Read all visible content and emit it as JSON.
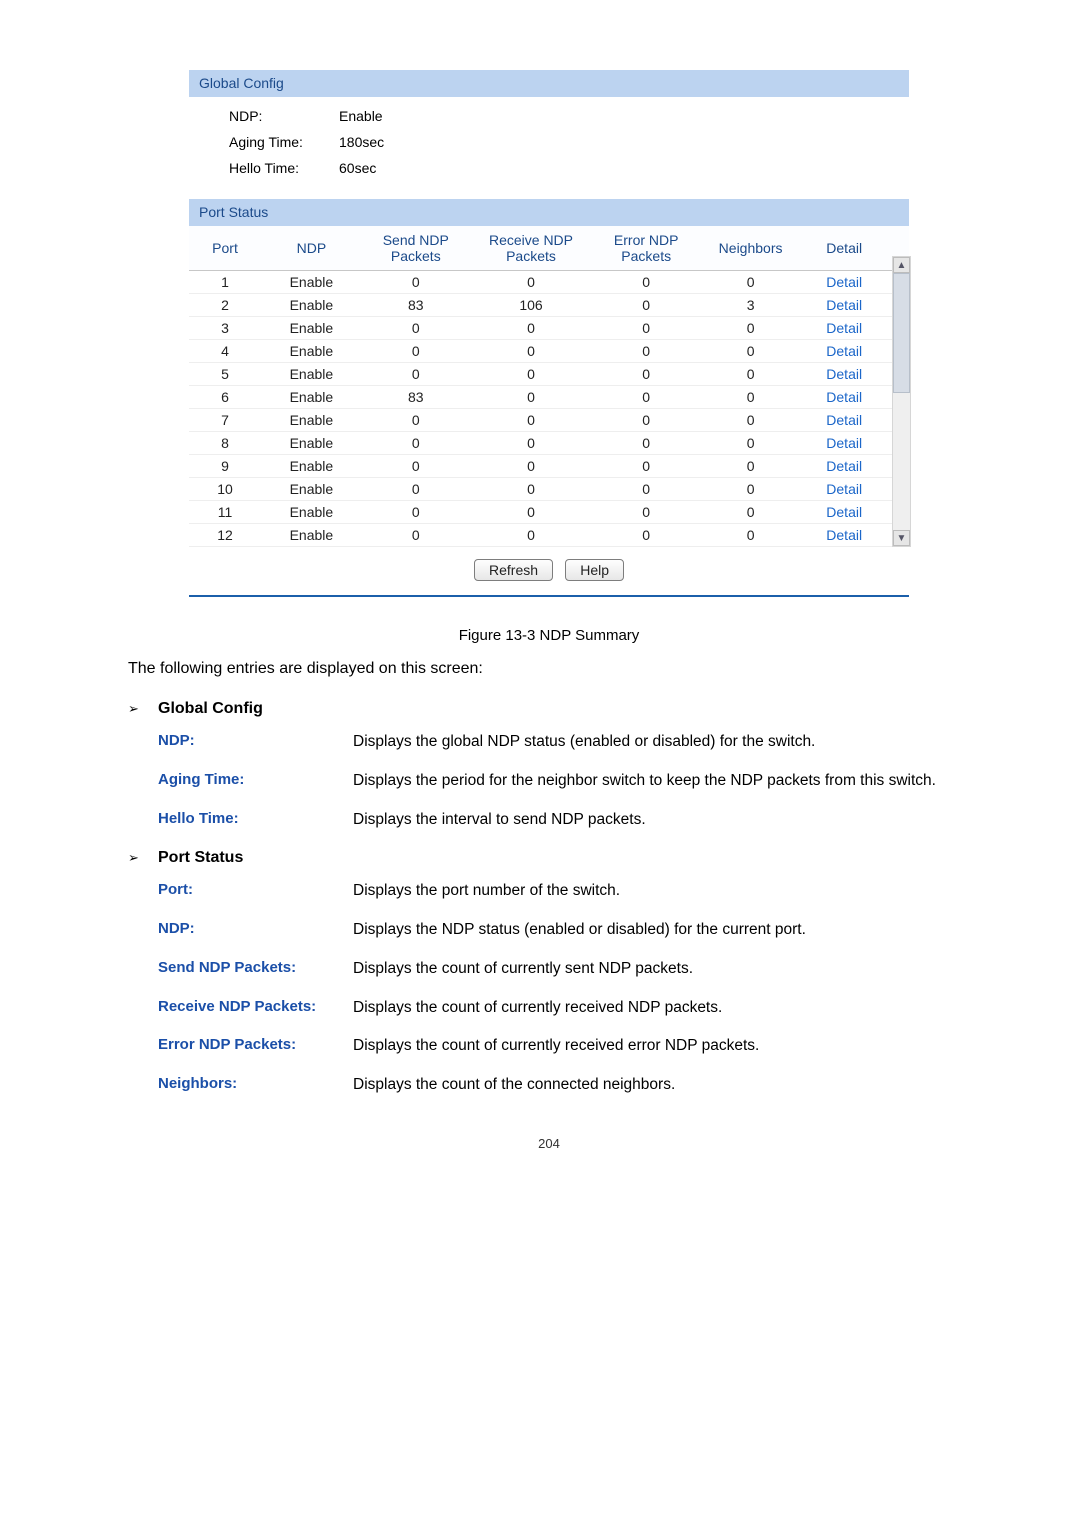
{
  "panel": {
    "global_header": "Global Config",
    "rows": [
      {
        "label": "NDP:",
        "value": "Enable"
      },
      {
        "label": "Aging Time:",
        "value": "180sec"
      },
      {
        "label": "Hello Time:",
        "value": "60sec"
      }
    ],
    "port_header": "Port Status",
    "columns": [
      "Port",
      "NDP",
      "Send NDP Packets",
      "Receive NDP Packets",
      "Error NDP Packets",
      "Neighbors",
      "Detail"
    ],
    "rows_data": [
      {
        "port": "1",
        "ndp": "Enable",
        "send": "0",
        "recv": "0",
        "err": "0",
        "neigh": "0",
        "detail": "Detail"
      },
      {
        "port": "2",
        "ndp": "Enable",
        "send": "83",
        "recv": "106",
        "err": "0",
        "neigh": "3",
        "detail": "Detail"
      },
      {
        "port": "3",
        "ndp": "Enable",
        "send": "0",
        "recv": "0",
        "err": "0",
        "neigh": "0",
        "detail": "Detail"
      },
      {
        "port": "4",
        "ndp": "Enable",
        "send": "0",
        "recv": "0",
        "err": "0",
        "neigh": "0",
        "detail": "Detail"
      },
      {
        "port": "5",
        "ndp": "Enable",
        "send": "0",
        "recv": "0",
        "err": "0",
        "neigh": "0",
        "detail": "Detail"
      },
      {
        "port": "6",
        "ndp": "Enable",
        "send": "83",
        "recv": "0",
        "err": "0",
        "neigh": "0",
        "detail": "Detail"
      },
      {
        "port": "7",
        "ndp": "Enable",
        "send": "0",
        "recv": "0",
        "err": "0",
        "neigh": "0",
        "detail": "Detail"
      },
      {
        "port": "8",
        "ndp": "Enable",
        "send": "0",
        "recv": "0",
        "err": "0",
        "neigh": "0",
        "detail": "Detail"
      },
      {
        "port": "9",
        "ndp": "Enable",
        "send": "0",
        "recv": "0",
        "err": "0",
        "neigh": "0",
        "detail": "Detail"
      },
      {
        "port": "10",
        "ndp": "Enable",
        "send": "0",
        "recv": "0",
        "err": "0",
        "neigh": "0",
        "detail": "Detail"
      },
      {
        "port": "11",
        "ndp": "Enable",
        "send": "0",
        "recv": "0",
        "err": "0",
        "neigh": "0",
        "detail": "Detail"
      },
      {
        "port": "12",
        "ndp": "Enable",
        "send": "0",
        "recv": "0",
        "err": "0",
        "neigh": "0",
        "detail": "Detail"
      }
    ],
    "buttons": {
      "refresh": "Refresh",
      "help": "Help"
    }
  },
  "figure_caption": "Figure 13-3 NDP Summary",
  "intro_text": "The following entries are displayed on this screen:",
  "sections": {
    "global": {
      "title": "Global Config",
      "defs": [
        {
          "term": "NDP:",
          "desc": "Displays the global NDP status (enabled or disabled) for the switch.",
          "justify": true
        },
        {
          "term": "Aging Time:",
          "desc": "Displays the period for the neighbor switch to keep the NDP packets from this switch.",
          "justify": true
        },
        {
          "term": "Hello Time:",
          "desc": "Displays the interval to send NDP packets.",
          "justify": false
        }
      ]
    },
    "port": {
      "title": "Port Status",
      "defs": [
        {
          "term": "Port:",
          "desc": "Displays the port number of the switch.",
          "justify": false
        },
        {
          "term": "NDP:",
          "desc": "Displays the NDP status (enabled or disabled) for the current port.",
          "justify": false
        },
        {
          "term": "Send NDP Packets:",
          "desc": "Displays the count of currently sent NDP packets.",
          "justify": false
        },
        {
          "term": "Receive NDP Packets:",
          "desc": "Displays the count of currently received NDP packets.",
          "justify": false
        },
        {
          "term": "Error NDP Packets:",
          "desc": "Displays the count of currently received error NDP packets.",
          "justify": false
        },
        {
          "term": "Neighbors:",
          "desc": "Displays the count of the connected neighbors.",
          "justify": false
        }
      ]
    }
  },
  "bullet_symbol": "➢",
  "scroll_glyphs": {
    "up": "▲",
    "down": "▼"
  },
  "page_number": "204"
}
